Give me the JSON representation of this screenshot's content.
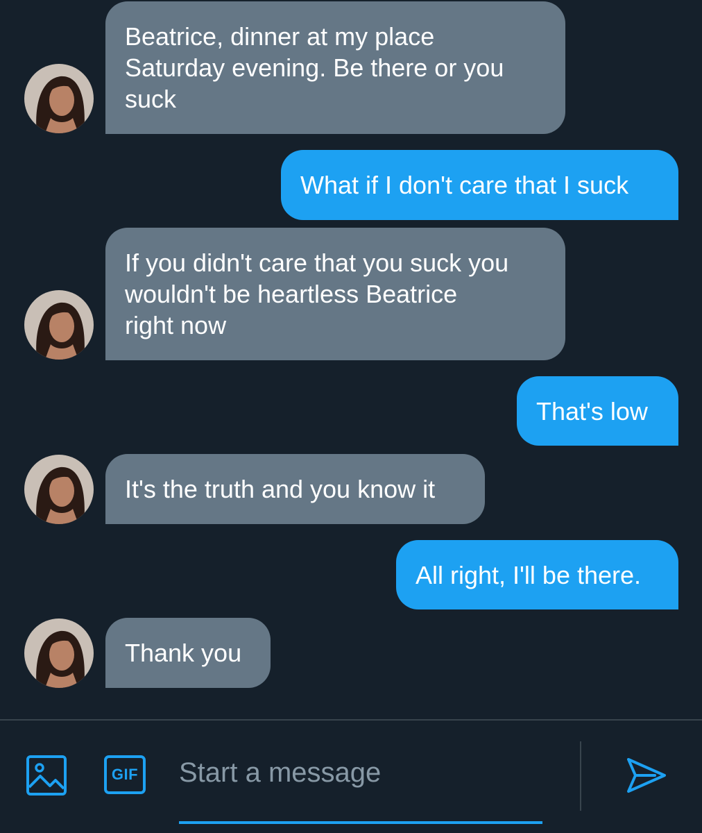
{
  "messages": [
    {
      "direction": "received",
      "lines": [
        "Beatrice, dinner at my place",
        "Saturday evening. Be there or you",
        "suck"
      ]
    },
    {
      "direction": "sent",
      "lines": [
        "What if I don't care that I suck"
      ]
    },
    {
      "direction": "received",
      "lines": [
        "If you didn't care that you suck you",
        "wouldn't be heartless Beatrice",
        "right now"
      ]
    },
    {
      "direction": "sent",
      "lines": [
        "That's low"
      ]
    },
    {
      "direction": "received",
      "lines": [
        "It's the truth and you know it"
      ]
    },
    {
      "direction": "sent",
      "lines": [
        "All right, I'll be there."
      ]
    },
    {
      "direction": "received",
      "lines": [
        "Thank you"
      ]
    }
  ],
  "composer": {
    "placeholder": "Start a message",
    "gif_label": "GIF",
    "media_icon": "image-icon",
    "send_icon": "send-icon"
  },
  "colors": {
    "background": "#15202b",
    "received_bubble": "#657786",
    "sent_bubble": "#1da1f2",
    "accent": "#1da1f2",
    "divider": "#38444d"
  }
}
